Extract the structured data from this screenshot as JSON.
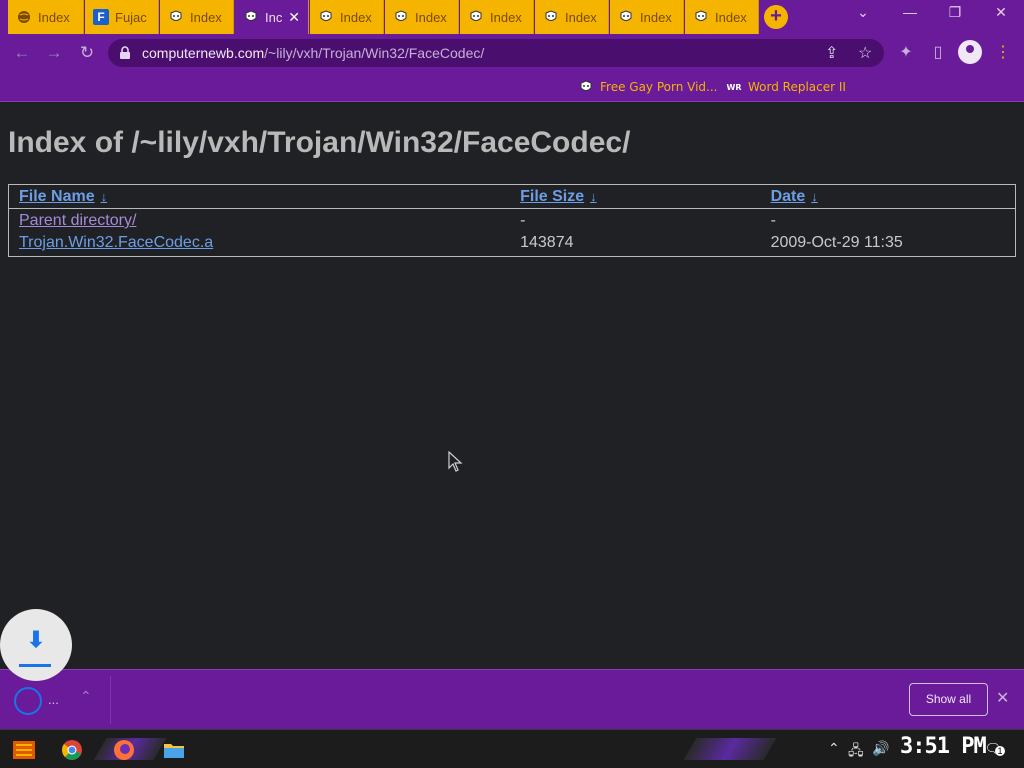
{
  "tabs": [
    {
      "label": "Index",
      "icon": "globe-icon"
    },
    {
      "label": "Fujac",
      "icon": "f-logo-icon"
    },
    {
      "label": "Index",
      "icon": "hacker-mask-icon"
    },
    {
      "label": "Inc",
      "icon": "hacker-mask-icon",
      "active": true
    },
    {
      "label": "Index",
      "icon": "hacker-mask-icon"
    },
    {
      "label": "Index",
      "icon": "hacker-mask-icon"
    },
    {
      "label": "Index",
      "icon": "hacker-mask-icon"
    },
    {
      "label": "Index",
      "icon": "hacker-mask-icon"
    },
    {
      "label": "Index",
      "icon": "hacker-mask-icon"
    },
    {
      "label": "Index",
      "icon": "hacker-mask-icon"
    }
  ],
  "toolbar": {
    "url_host": "computernewb.com",
    "url_path": "/~lily/vxh/Trojan/Win32/FaceCodec/"
  },
  "bookmarks": [
    {
      "label": "Free Gay Porn Vid...",
      "icon": "hacker-mask-icon"
    },
    {
      "label": "Word Replacer II",
      "icon": "wr-icon"
    }
  ],
  "page": {
    "heading": "Index of /~lily/vxh/Trojan/Win32/FaceCodec/",
    "columns": {
      "name": "File Name",
      "size": "File Size",
      "date": "Date",
      "sort_glyph": "↓"
    },
    "rows": [
      {
        "name": "Parent directory/",
        "size": "-",
        "date": "-"
      },
      {
        "name": "Trojan.Win32.FaceCodec.a",
        "size": "143874",
        "date": "2009-Oct-29 11:35"
      }
    ]
  },
  "download_shelf": {
    "item_text": "...",
    "show_all": "Show all"
  },
  "taskbar": {
    "clock": "3:51 PM",
    "notification_count": "1"
  },
  "colors": {
    "accent_purple": "#6a1b9a",
    "tab_yellow": "#f5b400",
    "link_blue": "#6c9ee6"
  }
}
